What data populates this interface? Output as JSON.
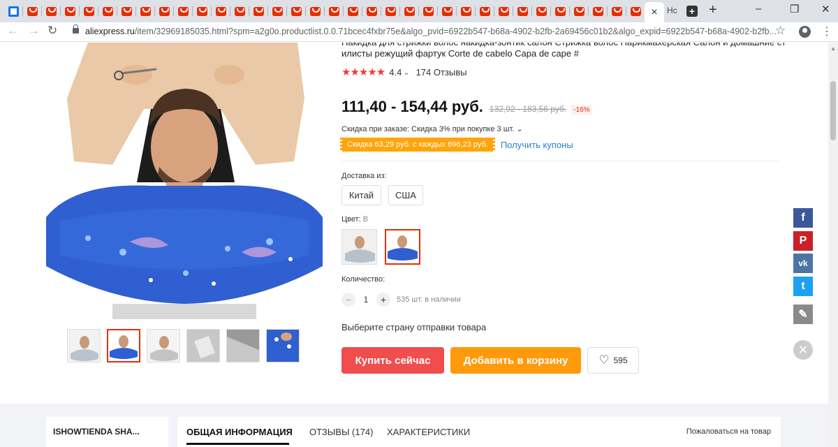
{
  "browser": {
    "tab_count_ae": 33,
    "active_tab_close": "×",
    "partial_tab_title": "Нс",
    "new_tab_symbol": "+",
    "window_controls": [
      "–",
      "❐",
      "✕"
    ],
    "url_host": "aliexpress.ru",
    "url_path": "/item/32969185035.html?spm=a2g0o.productlist.0.0.71bcec4fxbr75e&algo_pvid=6922b547-b68a-4902-b2fb-2a69456c01b2&algo_expid=6922b547-b68a-4902-b2fb...",
    "icons": {
      "back": "arrow-left-icon",
      "forward": "arrow-right-icon",
      "reload": "reload-icon",
      "lock": "lock-icon",
      "bookmark": "star-icon",
      "profile": "account-icon",
      "menu": "kebab-menu-icon"
    }
  },
  "product": {
    "title": "Накидка для стрижки волос накидка-зонтик салон Стрижка волос Парикмахерская Салон и домашние ст илисты режущий фартук Corte de cabelo Capa de cape #",
    "stars": "★★★★★",
    "rating": "4.4",
    "rating_chevron": "⌄",
    "reviews": "174 Отзывы",
    "price": "111,40 - 154,44 руб.",
    "old_price": "132,92 - 183,56 руб.",
    "discount": "-16%",
    "order_discount": "Скидка при заказе: Скидка 3% при покупке 3 шт. ⌄",
    "coupon_tag": "Скидка 63,29 руб. с каждых 696,23 руб.",
    "coupon_link": "Получить купоны",
    "ship_from_label": "Доставка из:",
    "ship_from_options": [
      "Китай",
      "США"
    ],
    "color_label": "Цвет:",
    "color_value": "B",
    "quantity_label": "Количество:",
    "qty_minus": "−",
    "qty_value": "1",
    "qty_plus": "+",
    "stock": "535 шт. в наличии",
    "ship_country_prompt": "Выберите страну отправки товара",
    "buy_now": "Купить сейчас",
    "add_to_cart": "Добавить в корзину",
    "wishlist_count": "595",
    "heart_icon": "♡"
  },
  "social": [
    {
      "name": "facebook",
      "glyph": "f",
      "color": "#3b5998"
    },
    {
      "name": "pinterest",
      "glyph": "P",
      "color": "#cb2027"
    },
    {
      "name": "vk",
      "glyph": "vk",
      "color": "#4c75a3"
    },
    {
      "name": "twitter",
      "glyph": "t",
      "color": "#1da1f2"
    },
    {
      "name": "edit",
      "glyph": "✎",
      "color": "#8a8a8a"
    }
  ],
  "close_symbol": "✕",
  "lower": {
    "store_name": "ISHOWTIENDA SHA...",
    "tabs": [
      "ОБЩАЯ ИНФОРМАЦИЯ",
      "ОТЗЫВЫ (174)",
      "ХАРАКТЕРИСТИКИ"
    ],
    "complain": "Пожаловаться на товар"
  },
  "colors": {
    "accent_red": "#e62e04",
    "buy": "#f24d4d",
    "cart": "#ff9a0c",
    "coupon": "#ffa40a",
    "link": "#2e81c5"
  }
}
